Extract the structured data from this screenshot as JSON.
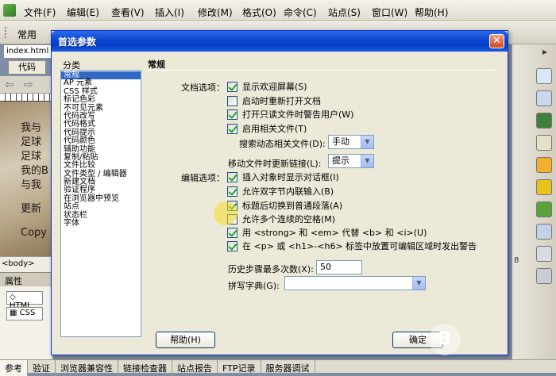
{
  "menubar": {
    "items": [
      "文件(F)",
      "编辑(E)",
      "查看(V)",
      "插入(I)",
      "修改(M)",
      "格式(O)",
      "命令(C)",
      "站点(S)",
      "窗口(W)",
      "帮助(H)"
    ]
  },
  "toolbar": {
    "common_label": "常用"
  },
  "document": {
    "tab_label": "index.html",
    "code_button": "代码",
    "design_lines": [
      "我与",
      "足球",
      "足球",
      "我的B",
      "与我",
      "更新",
      "Copy"
    ],
    "tag_selector": "<body>"
  },
  "properties": {
    "header": "属性",
    "html_button": "HTML",
    "css_button": "CSS"
  },
  "status_tabs": [
    "参考",
    "验证",
    "浏览器兼容性",
    "链接检查器",
    "站点报告",
    "FTP记录",
    "服务器调试"
  ],
  "right_dock": {
    "gutter_number": "8"
  },
  "dialog": {
    "title": "首选参数",
    "category_label": "分类",
    "categories": [
      "常规",
      "AP 元素",
      "CSS 样式",
      "标记色彩",
      "不可见元素",
      "代码改写",
      "代码格式",
      "代码提示",
      "代码颜色",
      "辅助功能",
      "复制/粘贴",
      "文件比较",
      "文件类型 / 编辑器",
      "新建文档",
      "验证程序",
      "在浏览器中预览",
      "站点",
      "状态栏",
      "字体"
    ],
    "selected_category": 0,
    "section_title": "常规",
    "doc_options_label": "文档选项：",
    "doc_options": [
      {
        "label": "显示欢迎屏幕(S)",
        "checked": true
      },
      {
        "label": "启动时重新打开文档",
        "checked": false
      },
      {
        "label": "打开只读文件时警告用户(W)",
        "checked": true
      },
      {
        "label": "启用相关文件(T)",
        "checked": true
      }
    ],
    "search_related_label": "搜索动态相关文件(D):",
    "search_related_value": "手动",
    "move_update_label": "移动文件时更新链接(L):",
    "move_update_value": "提示",
    "edit_options_label": "编辑选项：",
    "edit_options": [
      {
        "label": "插入对象时显示对话框(I)",
        "checked": true
      },
      {
        "label": "允许双字节内联输入(B)",
        "checked": true
      },
      {
        "label": "标题后切换到普通段落(A)",
        "checked": true
      },
      {
        "label": "允许多个连续的空格(M)",
        "checked": false
      },
      {
        "label": "用 <strong> 和 <em> 代替 <b> 和 <i>(U)",
        "checked": true
      },
      {
        "label": "在 <p> 或 <h1>-<h6> 标签中放置可编辑区域时发出警告",
        "checked": true
      }
    ],
    "history_label": "历史步骤最多次数(X):",
    "history_value": "50",
    "spell_dict_label": "拼写字典(G):",
    "spell_dict_value": "",
    "help_button": "帮助(H)",
    "ok_button": "确定",
    "close_glyph": "✕"
  },
  "watermark_glyph": "B"
}
